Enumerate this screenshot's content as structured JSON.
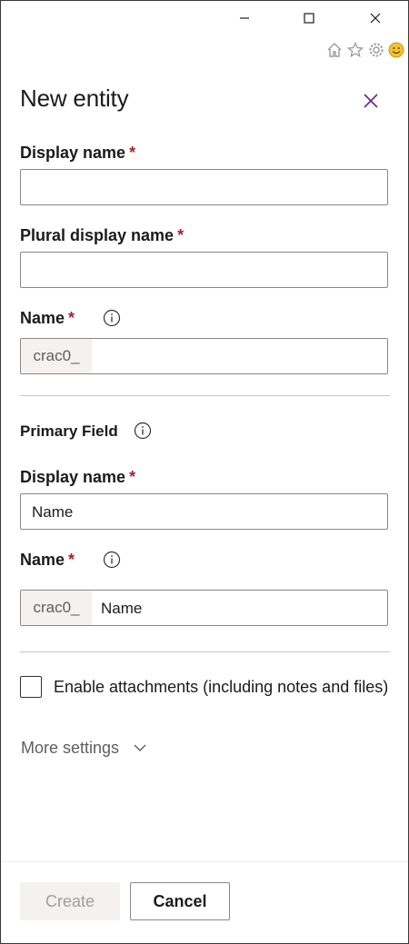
{
  "window": {
    "minimize_icon": "minimize-icon",
    "maximize_icon": "maximize-icon",
    "close_icon": "close-icon"
  },
  "browser_icons": [
    "home-icon",
    "star-icon",
    "gear-icon",
    "smiley-icon"
  ],
  "panel": {
    "title": "New entity",
    "close_icon": "close-icon"
  },
  "entity": {
    "display_name_label": "Display name",
    "display_name_value": "",
    "plural_display_name_label": "Plural display name",
    "plural_display_name_value": "",
    "name_label": "Name",
    "name_prefix": "crac0_",
    "name_value": "",
    "required_marker": "*"
  },
  "primary_field": {
    "section_label": "Primary Field",
    "display_name_label": "Display name",
    "display_name_value": "Name",
    "name_label": "Name",
    "name_prefix": "crac0_",
    "name_value": "Name"
  },
  "attachments": {
    "label": "Enable attachments (including notes and files)",
    "checked": false
  },
  "more_settings": {
    "label": "More settings",
    "icon": "chevron-down-icon"
  },
  "footer": {
    "create_label": "Create",
    "cancel_label": "Cancel"
  },
  "colors": {
    "required": "#a4262c",
    "panel_close": "#6b2f8c",
    "disabled_bg": "#f3f2f1",
    "disabled_text": "#a19f9d"
  }
}
